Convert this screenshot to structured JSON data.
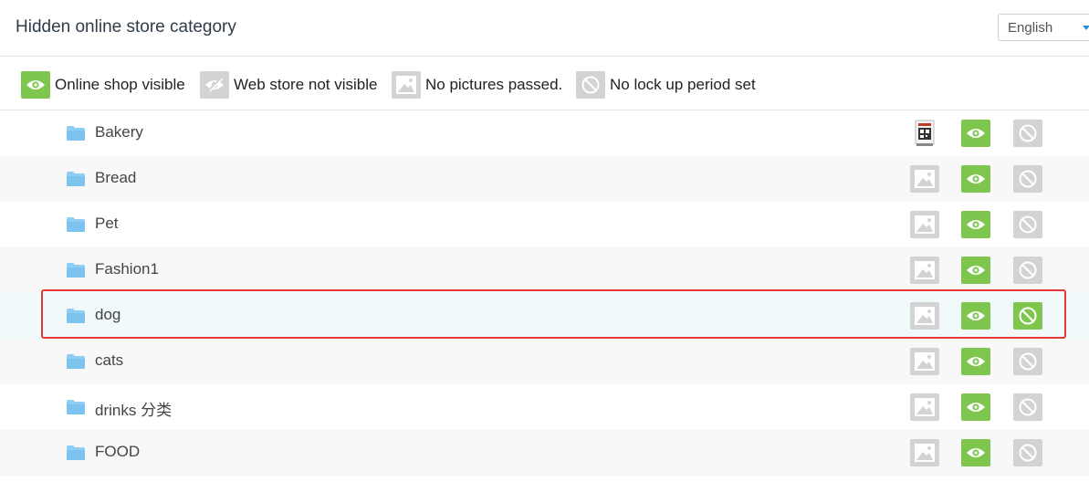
{
  "header": {
    "title": "Hidden online store category",
    "language": "English"
  },
  "legend": [
    {
      "icon": "eye-icon",
      "label": "Online shop visible"
    },
    {
      "icon": "eye-slash-icon",
      "label": "Web store not visible"
    },
    {
      "icon": "picture-icon",
      "label": "No pictures passed."
    },
    {
      "icon": "no-lock-icon",
      "label": "No lock up period set"
    }
  ],
  "categories": [
    {
      "name": "Bakery",
      "picture": "qr-thumbnail-icon",
      "visible": true,
      "lock_set": false
    },
    {
      "name": "Bread",
      "picture": "picture-icon",
      "visible": true,
      "lock_set": false
    },
    {
      "name": "Pet",
      "picture": "picture-icon",
      "visible": true,
      "lock_set": false
    },
    {
      "name": "Fashion1",
      "picture": "picture-icon",
      "visible": true,
      "lock_set": false
    },
    {
      "name": "dog",
      "picture": "picture-icon",
      "visible": true,
      "lock_set": true,
      "highlighted": true
    },
    {
      "name": "cats",
      "picture": "picture-icon",
      "visible": true,
      "lock_set": false
    },
    {
      "name": "drinks 分类",
      "picture": "picture-icon",
      "visible": true,
      "lock_set": false
    },
    {
      "name": "FOOD",
      "picture": "picture-icon",
      "visible": true,
      "lock_set": false
    }
  ],
  "colors": {
    "green": "#7fc64f",
    "gray": "#d3d3d3",
    "folder": "#8fcef3",
    "highlight_border": "#e53935"
  }
}
